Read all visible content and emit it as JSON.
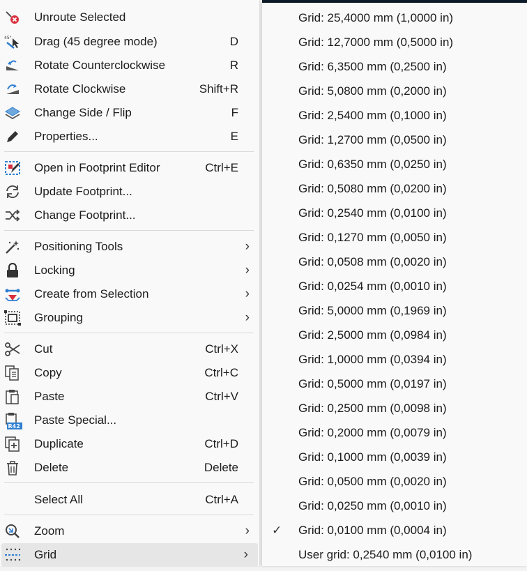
{
  "menu": {
    "items": [
      {
        "label": "Unroute Selected",
        "shortcut": "",
        "icon": "unroute-icon"
      },
      {
        "label": "Drag (45 degree mode)",
        "shortcut": "D",
        "icon": "drag-45-icon"
      },
      {
        "label": "Rotate Counterclockwise",
        "shortcut": "R",
        "icon": "rotate-ccw-icon"
      },
      {
        "label": "Rotate Clockwise",
        "shortcut": "Shift+R",
        "icon": "rotate-cw-icon"
      },
      {
        "label": "Change Side / Flip",
        "shortcut": "F",
        "icon": "flip-icon"
      },
      {
        "label": "Properties...",
        "shortcut": "E",
        "icon": "pencil-icon"
      },
      {
        "label": "Open in Footprint Editor",
        "shortcut": "Ctrl+E",
        "icon": "footprint-editor-icon"
      },
      {
        "label": "Update Footprint...",
        "shortcut": "",
        "icon": "refresh-icon"
      },
      {
        "label": "Change Footprint...",
        "shortcut": "",
        "icon": "shuffle-icon"
      },
      {
        "label": "Positioning Tools",
        "shortcut": "",
        "icon": "magic-wand-icon"
      },
      {
        "label": "Locking",
        "shortcut": "",
        "icon": "lock-icon"
      },
      {
        "label": "Create from Selection",
        "shortcut": "",
        "icon": "create-from-selection-icon"
      },
      {
        "label": "Grouping",
        "shortcut": "",
        "icon": "group-icon"
      },
      {
        "label": "Cut",
        "shortcut": "Ctrl+X",
        "icon": "scissors-icon"
      },
      {
        "label": "Copy",
        "shortcut": "Ctrl+C",
        "icon": "copy-icon"
      },
      {
        "label": "Paste",
        "shortcut": "Ctrl+V",
        "icon": "paste-icon"
      },
      {
        "label": "Paste Special...",
        "shortcut": "",
        "icon": "paste-special-icon",
        "badge": "R42"
      },
      {
        "label": "Duplicate",
        "shortcut": "Ctrl+D",
        "icon": "duplicate-icon"
      },
      {
        "label": "Delete",
        "shortcut": "Delete",
        "icon": "trash-icon"
      },
      {
        "label": "Select All",
        "shortcut": "Ctrl+A",
        "icon": ""
      },
      {
        "label": "Zoom",
        "shortcut": "",
        "icon": "zoom-icon"
      },
      {
        "label": "Grid",
        "shortcut": "",
        "icon": "grid-icon"
      }
    ],
    "submenu_chevron": "›"
  },
  "grid_submenu": {
    "items": [
      "Grid: 25,4000 mm (1,0000 in)",
      "Grid: 12,7000 mm (0,5000 in)",
      "Grid: 6,3500 mm (0,2500 in)",
      "Grid: 5,0800 mm (0,2000 in)",
      "Grid: 2,5400 mm (0,1000 in)",
      "Grid: 1,2700 mm (0,0500 in)",
      "Grid: 0,6350 mm (0,0250 in)",
      "Grid: 0,5080 mm (0,0200 in)",
      "Grid: 0,2540 mm (0,0100 in)",
      "Grid: 0,1270 mm (0,0050 in)",
      "Grid: 0,0508 mm (0,0020 in)",
      "Grid: 0,0254 mm (0,0010 in)",
      "Grid: 5,0000 mm (0,1969 in)",
      "Grid: 2,5000 mm (0,0984 in)",
      "Grid: 1,0000 mm (0,0394 in)",
      "Grid: 0,5000 mm (0,0197 in)",
      "Grid: 0,2500 mm (0,0098 in)",
      "Grid: 0,2000 mm (0,0079 in)",
      "Grid: 0,1000 mm (0,0039 in)",
      "Grid: 0,0500 mm (0,0020 in)",
      "Grid: 0,0250 mm (0,0010 in)",
      "Grid: 0,0100 mm (0,0004 in)",
      "User grid: 0,2540 mm (0,0100 in)"
    ],
    "checked_label": "Grid: 0,0100 mm (0,0004 in)",
    "check_glyph": "✓"
  },
  "colors": {
    "accent_blue": "#2f7fd1",
    "accent_red": "#d9303e",
    "icon_dark": "#333333",
    "highlight": "#e6e6e6"
  }
}
